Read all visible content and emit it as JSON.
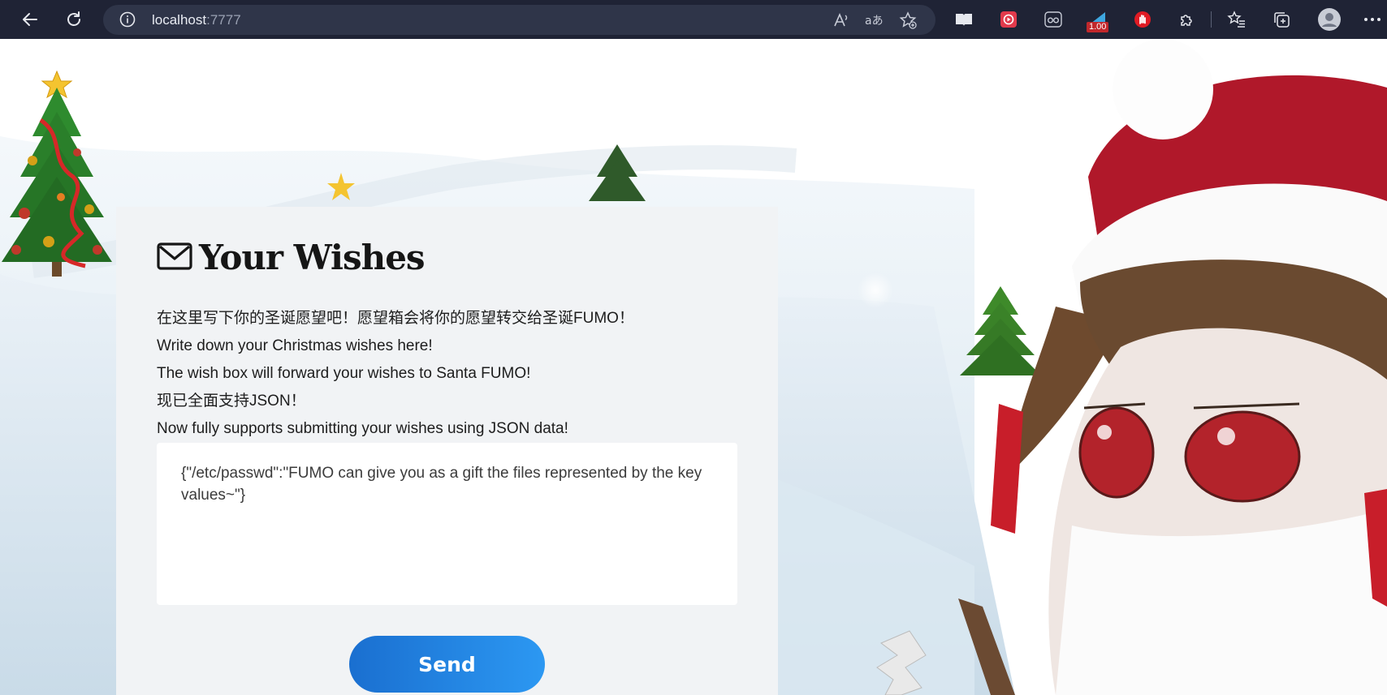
{
  "browser": {
    "url_host": "localhost",
    "url_port": ":7777",
    "extension_badge": "1.00",
    "icons": [
      "back-icon",
      "refresh-icon",
      "info-icon",
      "read-aloud-icon",
      "translate-icon",
      "favorite-add-icon",
      "reader-icon",
      "video-extension-icon",
      "glasses-extension-icon",
      "speed-extension-icon",
      "hand-extension-icon",
      "extensions-icon",
      "favorites-icon",
      "collections-icon",
      "profile-icon",
      "more-icon"
    ]
  },
  "page": {
    "title": "Your Wishes",
    "intro_lines": [
      "在这里写下你的圣诞愿望吧！愿望箱会将你的愿望转交给圣诞FUMO！",
      "Write down your Christmas wishes here!",
      "The wish box will forward your wishes to Santa FUMO!",
      "现已全面支持JSON！",
      "Now fully supports submitting your wishes using JSON data!"
    ],
    "wish_value": "{\"/etc/passwd\":\"FUMO can give you as a gift the files represented by the key values~\"}",
    "send_label": "Send"
  },
  "colors": {
    "chrome": "#1f2335",
    "address_bar": "#2f3549",
    "card": "#f1f3f5",
    "send_start": "#1a6fd0",
    "send_end": "#2c98f2"
  }
}
